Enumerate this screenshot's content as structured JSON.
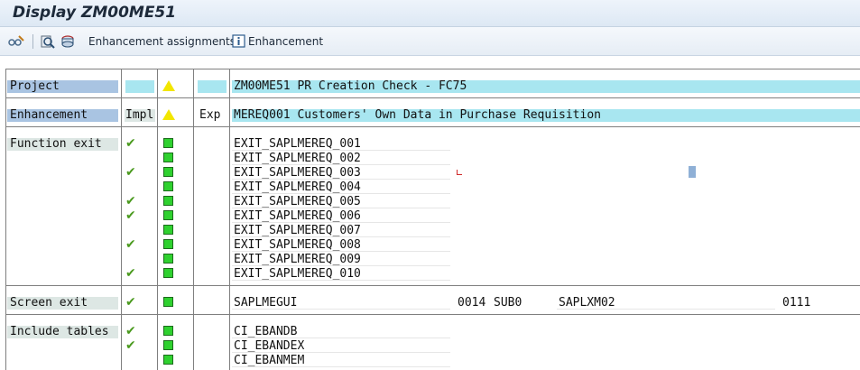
{
  "window": {
    "title": "Display ZM00ME51"
  },
  "toolbar": {
    "enhancement_assignments": "Enhancement assignments",
    "enhancement": "Enhancement"
  },
  "headers": {
    "project_label": "Project",
    "project_value": "ZM00ME51 PR Creation Check - FC75",
    "enhancement_label": "Enhancement",
    "impl": "Impl",
    "exp": "Exp",
    "enhancement_value": "MEREQ001 Customers' Own Data in Purchase Requisition"
  },
  "function_exit": {
    "label": "Function exit",
    "items": [
      {
        "name": "EXIT_SAPLMEREQ_001",
        "impl": true
      },
      {
        "name": "EXIT_SAPLMEREQ_002",
        "impl": false
      },
      {
        "name": "EXIT_SAPLMEREQ_003",
        "impl": true
      },
      {
        "name": "EXIT_SAPLMEREQ_004",
        "impl": false
      },
      {
        "name": "EXIT_SAPLMEREQ_005",
        "impl": true
      },
      {
        "name": "EXIT_SAPLMEREQ_006",
        "impl": true
      },
      {
        "name": "EXIT_SAPLMEREQ_007",
        "impl": false
      },
      {
        "name": "EXIT_SAPLMEREQ_008",
        "impl": true
      },
      {
        "name": "EXIT_SAPLMEREQ_009",
        "impl": false
      },
      {
        "name": "EXIT_SAPLMEREQ_010",
        "impl": true
      }
    ]
  },
  "screen_exit": {
    "label": "Screen exit",
    "program": "SAPLMEGUI",
    "screen": "0014",
    "subscreen": "SUB0",
    "called_program": "SAPLXM02",
    "called_screen": "0111"
  },
  "include_tables": {
    "label": "Include tables",
    "items": [
      {
        "name": "CI_EBANDB",
        "impl": true
      },
      {
        "name": "CI_EBANDEX",
        "impl": true
      },
      {
        "name": "CI_EBANMEM",
        "impl": false
      }
    ]
  },
  "colors": {
    "check": "#4a9a1e",
    "status_green": "#2fd12f",
    "warning": "#f2e600",
    "header_blue": "#a9c4e2",
    "header_cyan": "#a8e6f0"
  }
}
